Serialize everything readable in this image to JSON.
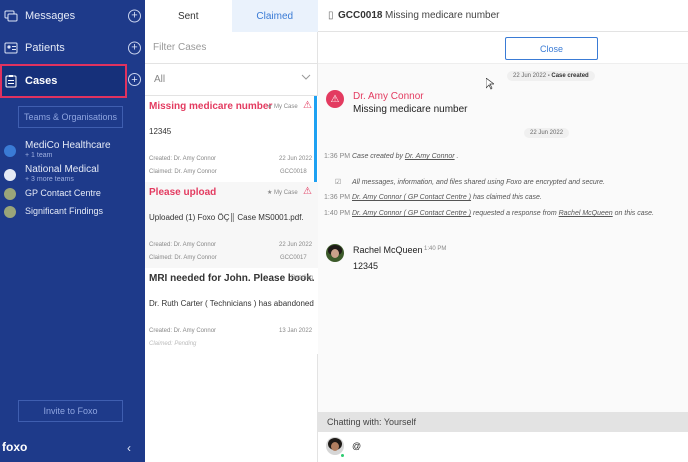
{
  "sidebar": {
    "items": [
      {
        "label": "Messages",
        "icon": "messages-icon"
      },
      {
        "label": "Patients",
        "icon": "patients-icon"
      },
      {
        "label": "Cases",
        "icon": "cases-icon"
      }
    ],
    "teams_button": "Teams & Organisations",
    "orgs": [
      {
        "name": "MediCo Healthcare",
        "sub": "+ 1 team"
      },
      {
        "name": "National Medical",
        "sub": "+ 3 more teams"
      },
      {
        "name": "GP Contact Centre"
      },
      {
        "name": "Significant Findings"
      }
    ],
    "invite_button": "Invite to Foxo",
    "logo": "foxo",
    "plus": "+",
    "collapse": "‹"
  },
  "list": {
    "tabs": [
      {
        "label": "Sent"
      },
      {
        "label": "Claimed"
      }
    ],
    "filter_placeholder": "Filter Cases",
    "select_value": "All",
    "cases": [
      {
        "title": "Missing medicare number",
        "tag": "★ My Case",
        "message": "12345",
        "created": "Created: Dr. Amy Connor",
        "claimed": "Claimed:  Dr. Amy Connor",
        "date": "22 Jun 2022",
        "code": "GCC0018"
      },
      {
        "title": "Please upload",
        "tag": "★ My Case",
        "message": "Uploaded (1) Foxo ÔÇ║ Case MS0001.pdf.",
        "created": "Created: Dr. Amy Connor",
        "claimed": "Claimed:  Dr. Amy Connor",
        "date": "22 Jun 2022",
        "code": "GCC0017"
      },
      {
        "title": "MRI needed for John. Please book.",
        "tag": "Pending",
        "message": "Dr. Ruth Carter ( Technicians ) has abandoned t...",
        "created": "Created: Dr. Amy Connor",
        "claimed": "Claimed:  Pending",
        "date": "13 Jan 2022"
      }
    ]
  },
  "detail": {
    "header_code": "GCC0018",
    "header_title": "Missing medicare number",
    "close_button": "Close",
    "pill_created_date": "22 Jun 2022",
    "pill_created_label": " - Case created",
    "author": "Dr. Amy Connor",
    "case_title": "Missing medicare number",
    "day_pill": "22 Jun 2022",
    "events": [
      {
        "time": "1:36 PM",
        "pre": "Case created by ",
        "who": "Dr. Amy Connor",
        "post": " ."
      },
      {
        "time": "",
        "pre": "All messages, information, and files shared using Foxo are encrypted and secure.",
        "who": "",
        "post": ""
      },
      {
        "time": "1:36 PM",
        "pre": "",
        "who": "Dr. Amy Connor ( GP Contact Centre )",
        "post": " has claimed this case."
      },
      {
        "time": "1:40 PM",
        "pre": "",
        "who": "Dr. Amy Connor ( GP Contact Centre )",
        "post": " requested a response from ",
        "who2": "Rachel McQueen",
        "post2": " on this case."
      }
    ],
    "message": {
      "name": "Rachel McQueen",
      "time": "1:40 PM",
      "text": "12345"
    },
    "chatting_with": "Chatting with: Yourself",
    "composer_value": "@"
  },
  "colors": {
    "sidebar": "#1e3a8a",
    "accent": "#3a7bd5",
    "alert": "#e33b60",
    "highlight": "#e0325f"
  }
}
